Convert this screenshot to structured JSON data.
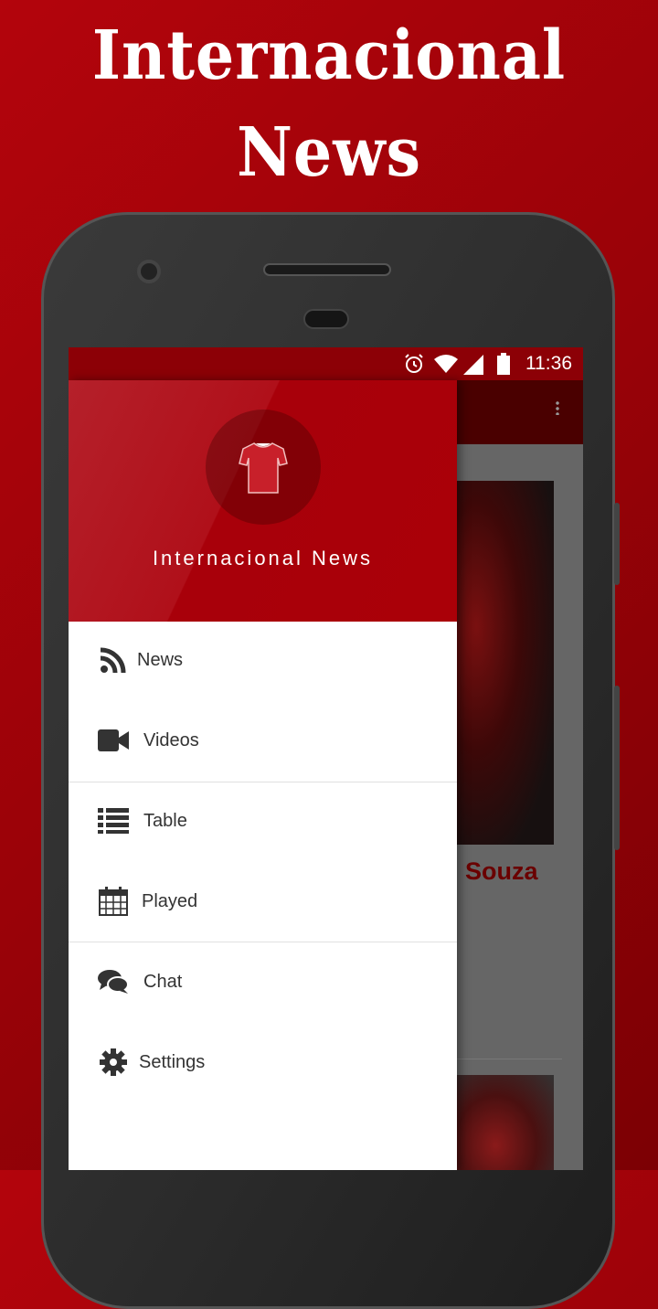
{
  "promo": {
    "line1": "Internacional",
    "line2": "News"
  },
  "status_bar": {
    "time": "11:36",
    "icons": [
      "alarm-icon",
      "wifi-icon",
      "signal-icon",
      "battery-icon"
    ]
  },
  "drawer": {
    "title": "Internacional News",
    "logo_icon": "jersey-icon",
    "items": [
      {
        "label": "News",
        "icon": "rss-icon"
      },
      {
        "label": "Videos",
        "icon": "video-camera-icon"
      },
      {
        "label": "Table",
        "icon": "list-icon"
      },
      {
        "label": "Played",
        "icon": "calendar-icon"
      },
      {
        "label": "Chat",
        "icon": "chat-icon"
      },
      {
        "label": "Settings",
        "icon": "gear-icon"
      }
    ]
  },
  "content": {
    "headline_fragment": "Souza"
  },
  "colors": {
    "brand": "#aa0008",
    "status_bar": "#8c0006",
    "text": "#333333"
  }
}
